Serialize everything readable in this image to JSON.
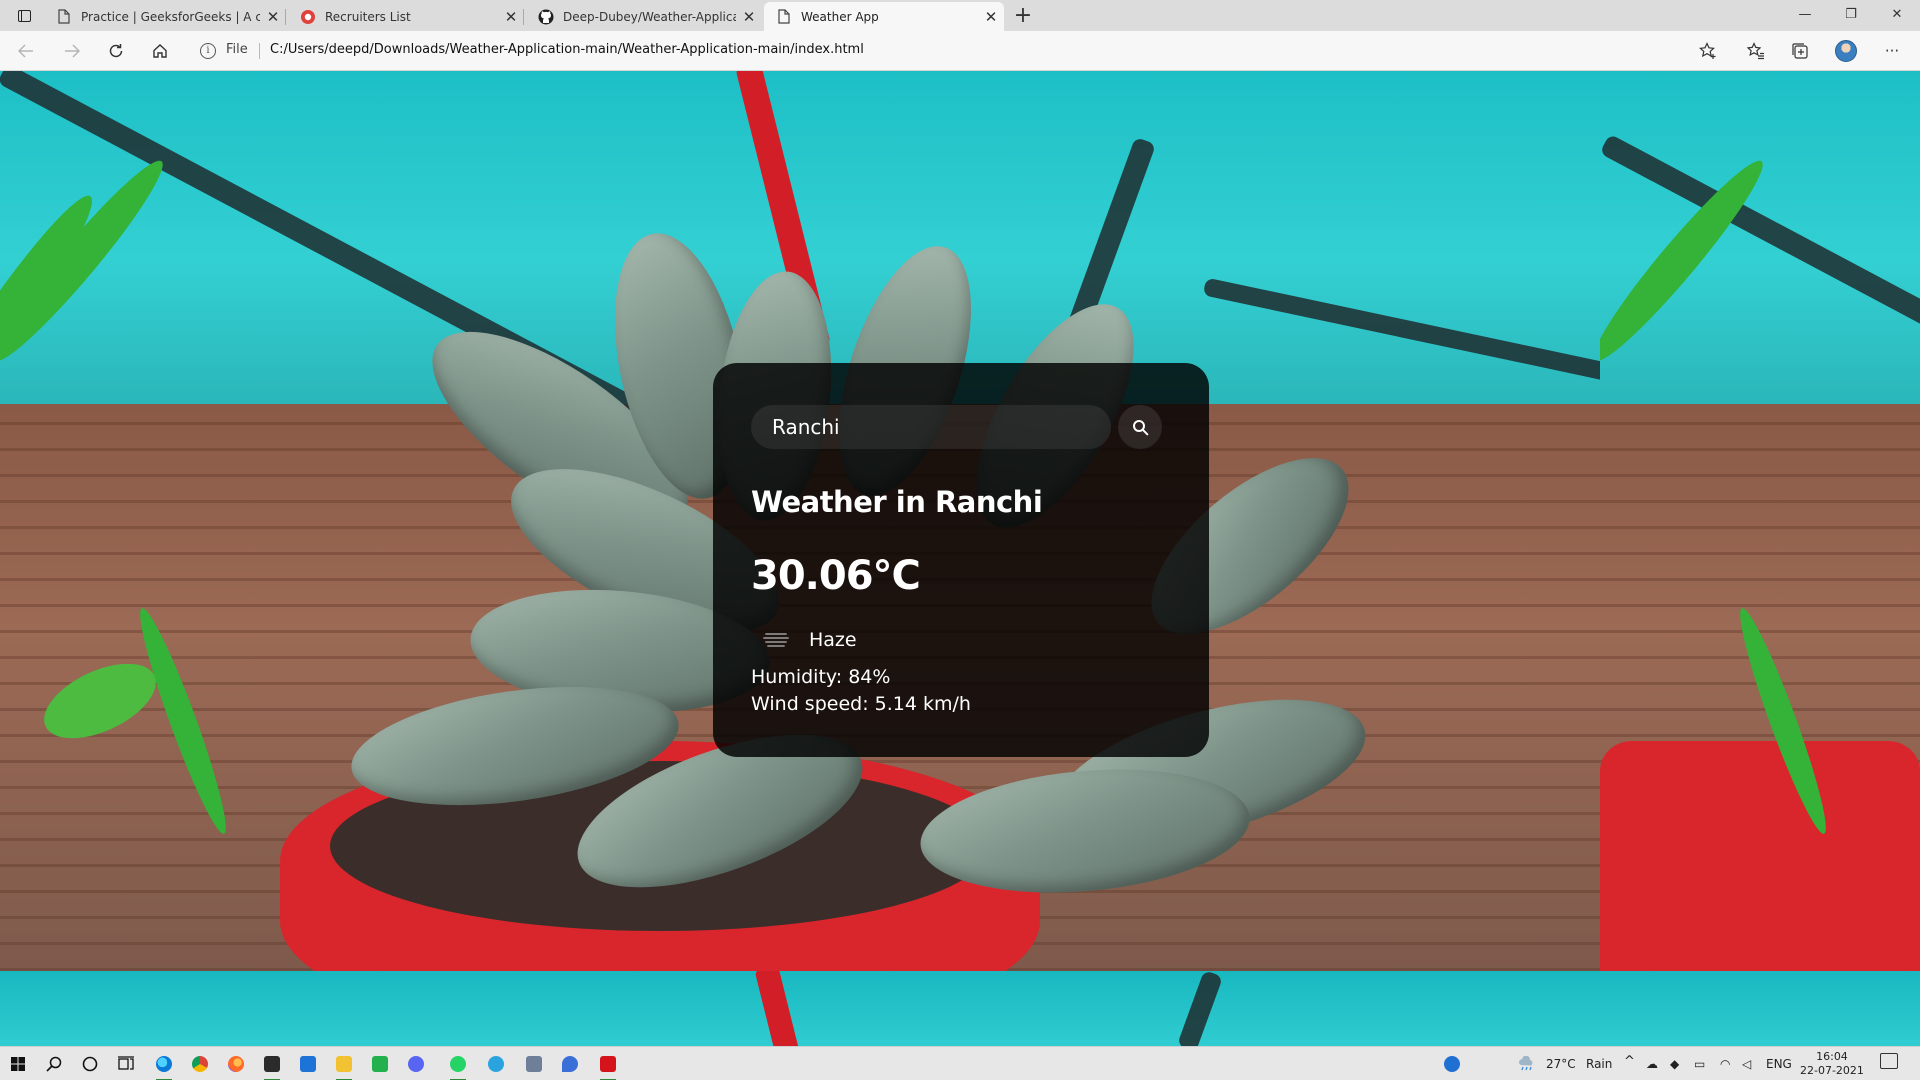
{
  "browser": {
    "tabs": [
      {
        "title": "Practice | GeeksforGeeks | A computer science portal for geeks",
        "icon": "document-icon",
        "active": false
      },
      {
        "title": "Recruiters List",
        "icon": "recruiters-favicon",
        "active": false
      },
      {
        "title": "Deep-Dubey/Weather-Application",
        "icon": "github-icon",
        "active": false
      },
      {
        "title": "Weather App",
        "icon": "document-icon",
        "active": true
      }
    ],
    "close_glyph": "✕",
    "new_tab_glyph": "+",
    "file_label": "File",
    "url": "C:/Users/deepd/Downloads/Weather-Application-main/Weather-Application-main/index.html",
    "window_controls": {
      "minimize": "—",
      "maximize": "❐",
      "close": "✕"
    },
    "more_glyph": "···"
  },
  "weather": {
    "search_value": "Ranchi",
    "city_heading": "Weather in Ranchi",
    "temperature": "30.06°C",
    "description": "Haze",
    "description_icon": "haze-icon",
    "humidity": "Humidity: 84%",
    "wind": "Wind speed: 5.14 km/h"
  },
  "taskbar": {
    "weather_temp": "27°C",
    "weather_desc": "Rain",
    "language": "ENG",
    "time": "16:04",
    "date": "22-07-2021"
  },
  "colors": {
    "card_bg": "#000000",
    "page_bg_sky": "#20c4c8",
    "pot_red": "#d8262c",
    "accent": "#0078d4"
  }
}
